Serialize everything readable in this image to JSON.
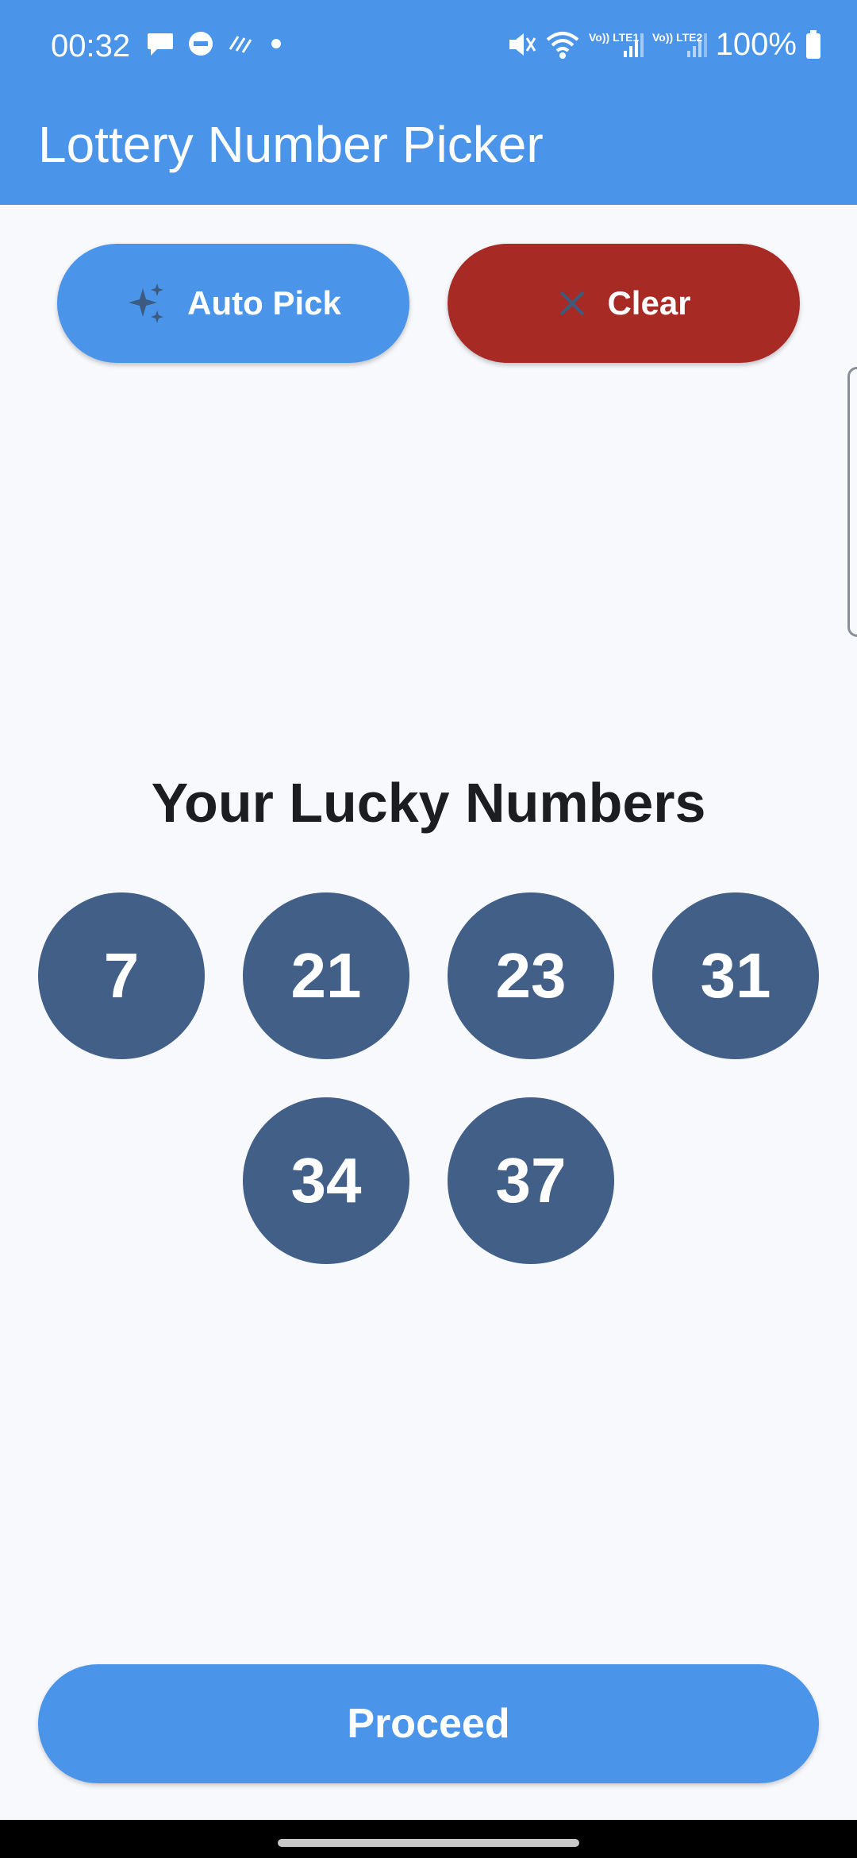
{
  "status_bar": {
    "time": "00:32",
    "battery": "100%",
    "icons": [
      "chat-bubble-icon",
      "do-not-disturb-icon",
      "stripes-icon",
      "dot-icon",
      "mute-icon",
      "wifi-icon",
      "lte1-signal-icon",
      "lte2-signal-icon",
      "battery-icon"
    ],
    "lte1_label": "Vo)) LTE1",
    "lte2_label": "Vo)) LTE2"
  },
  "app_bar": {
    "title": "Lottery Number Picker"
  },
  "actions": {
    "auto_pick_label": "Auto Pick",
    "auto_pick_icon": "sparkles-icon",
    "clear_label": "Clear",
    "clear_icon": "close-icon"
  },
  "lucky": {
    "title": "Your Lucky Numbers",
    "numbers": [
      "7",
      "21",
      "23",
      "31",
      "34",
      "37"
    ]
  },
  "footer": {
    "proceed_label": "Proceed"
  },
  "colors": {
    "primary": "#4a95e9",
    "danger": "#a82a25",
    "ball": "#425f88",
    "background": "#f7f9fd"
  }
}
